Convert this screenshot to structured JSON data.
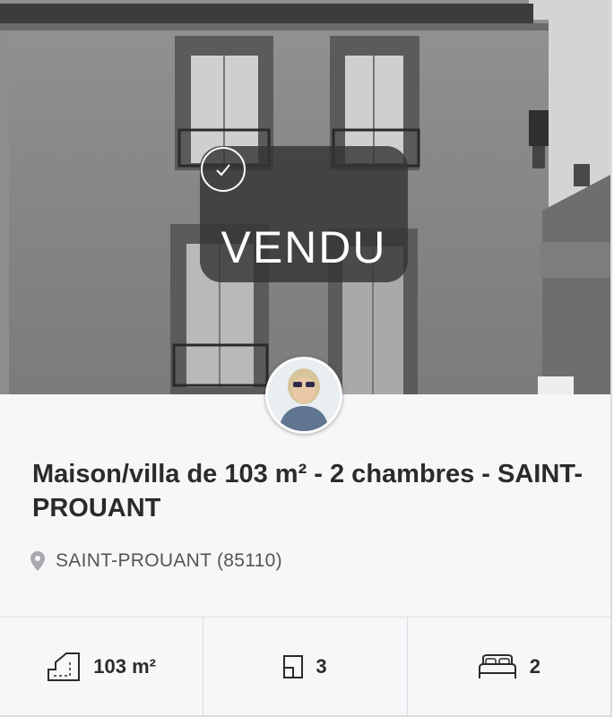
{
  "listing": {
    "status_label": "VENDU",
    "title": "Maison/villa de 103 m² - 2 chambres - SAINT-PROUANT",
    "location": "SAINT-PROUANT (85110)"
  },
  "stats": {
    "surface": "103 m²",
    "rooms": "3",
    "bedrooms": "2"
  },
  "icons": {
    "status": "check-circle-icon",
    "location": "map-pin-icon",
    "surface": "floor-plan-icon",
    "rooms": "room-icon",
    "bedrooms": "bed-icon"
  },
  "colors": {
    "card_background": "#f7f7f9",
    "overlay": "#343434",
    "text": "#2b2b2b",
    "muted_text": "#555555",
    "divider": "#dcdce2"
  }
}
